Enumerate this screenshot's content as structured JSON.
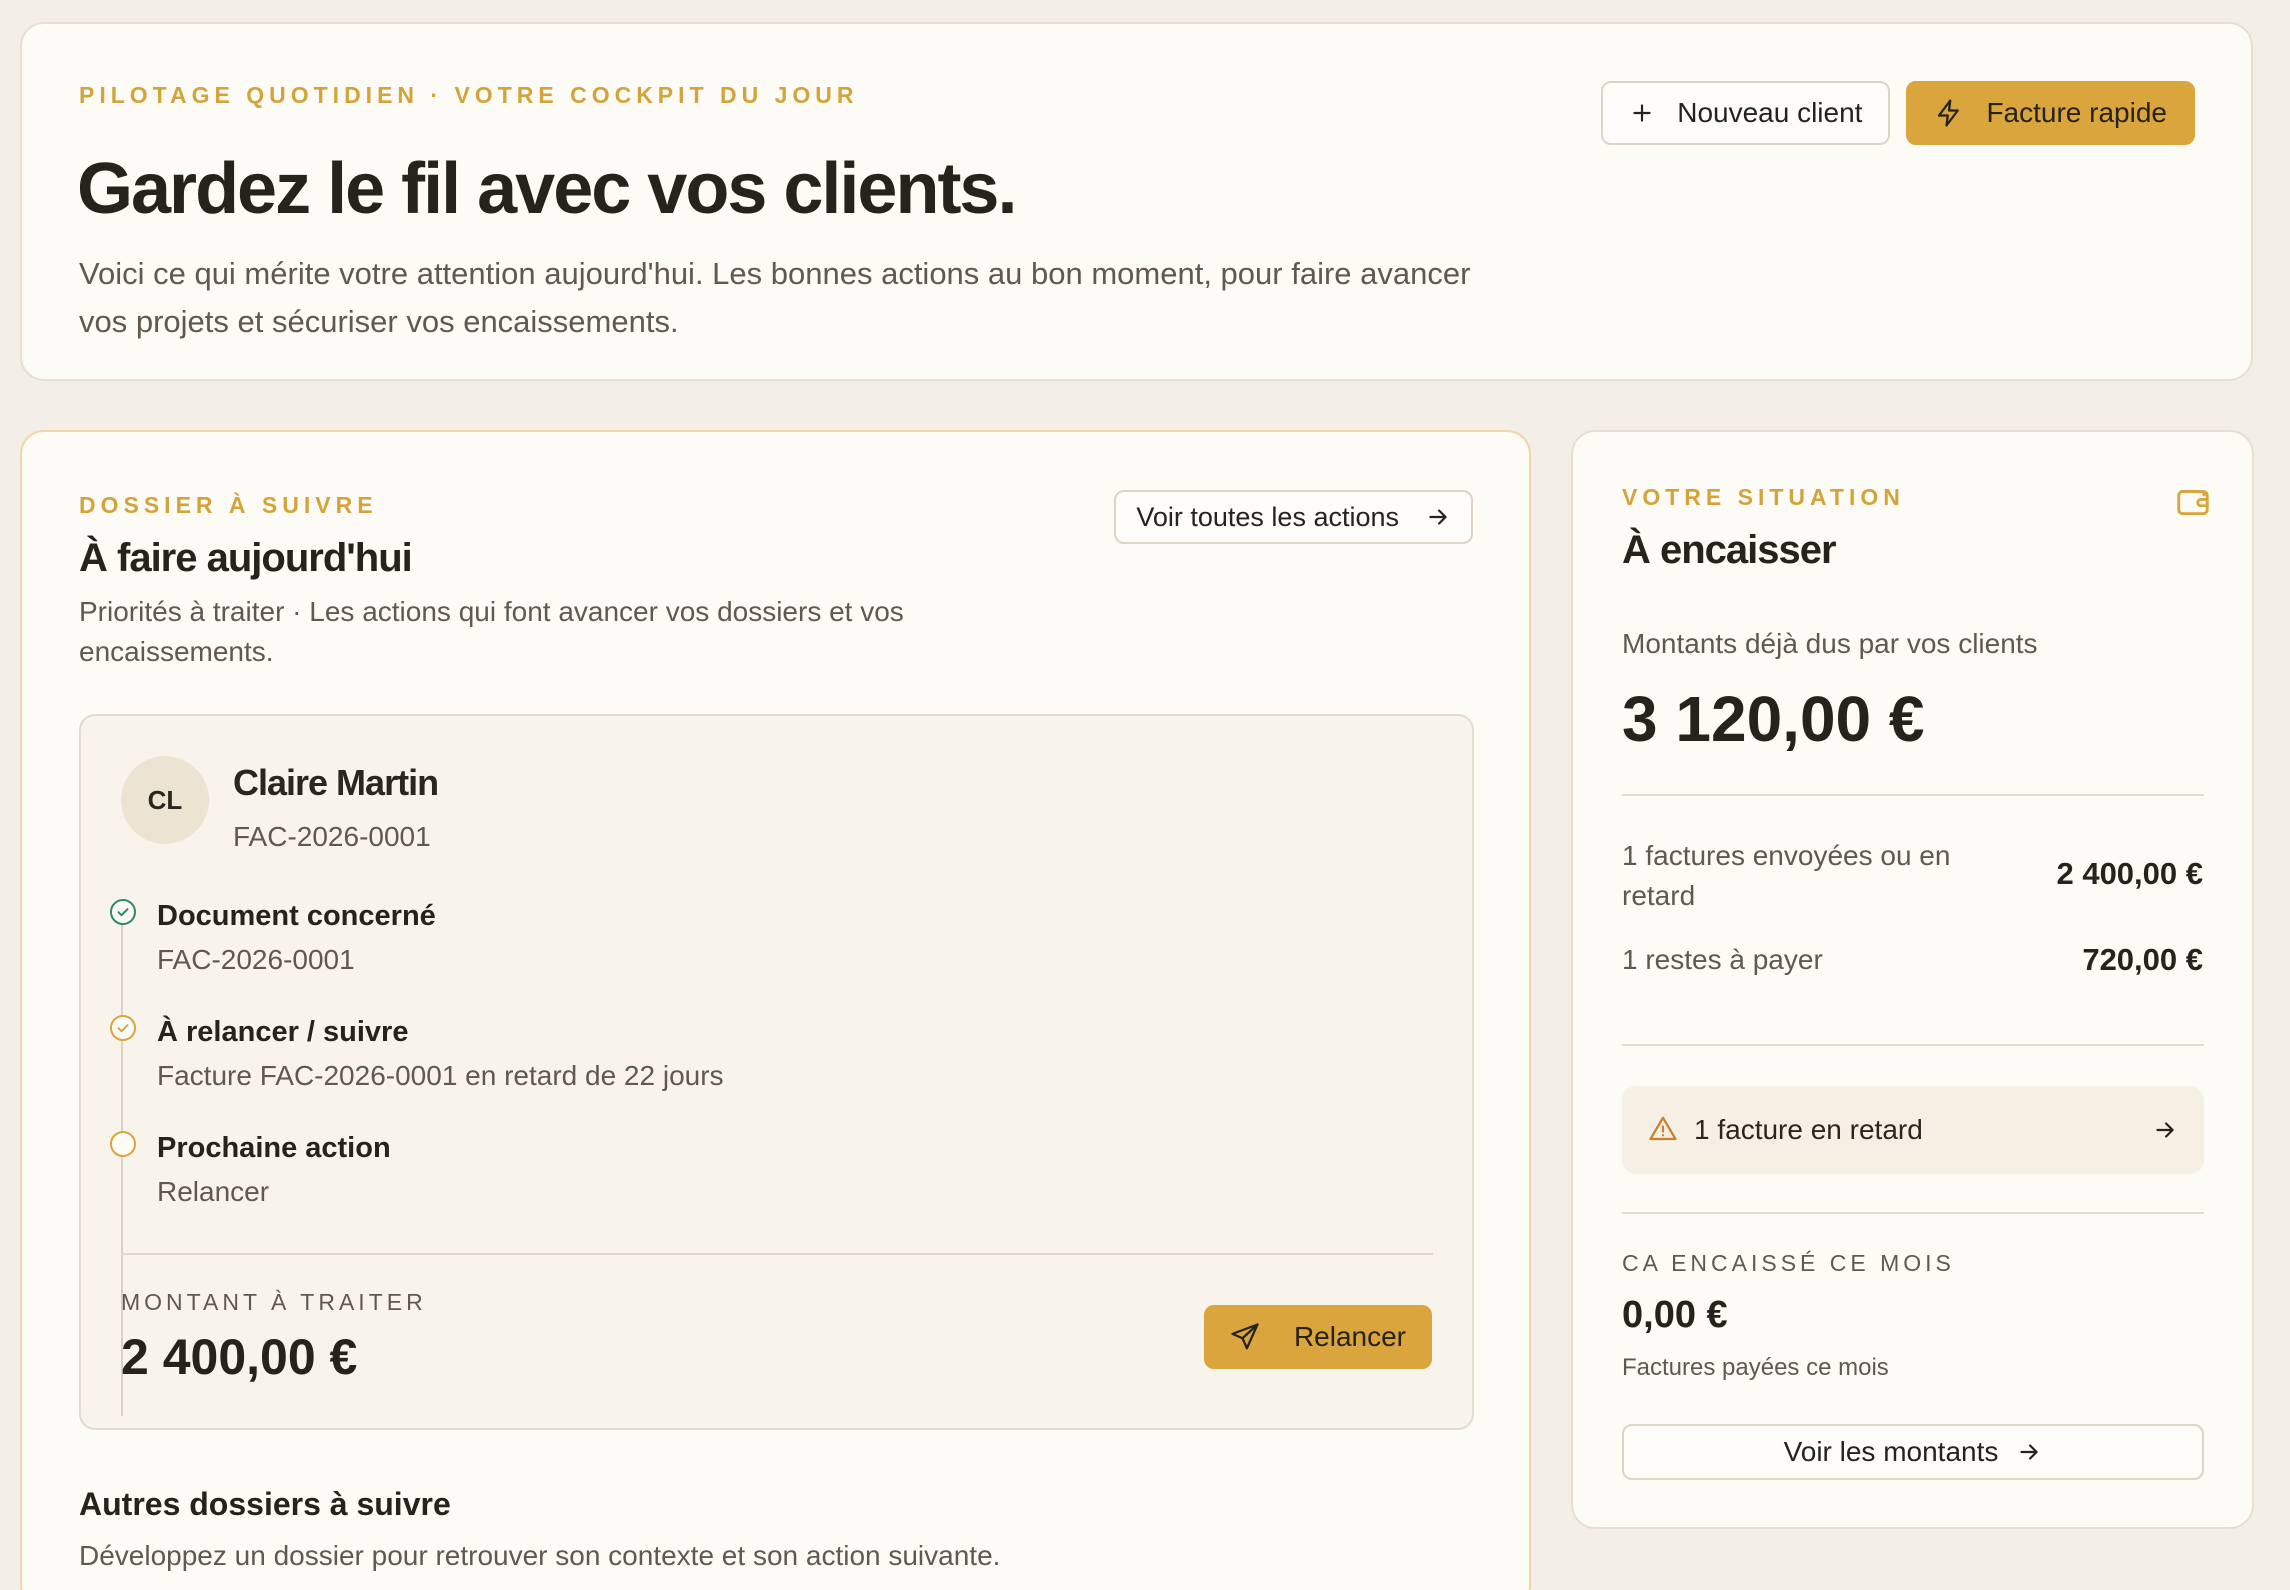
{
  "hero": {
    "eyebrow": "PILOTAGE QUOTIDIEN · VOTRE COCKPIT DU JOUR",
    "title": "Gardez le fil avec vos clients.",
    "subtitle": "Voici ce qui mérite votre attention aujourd'hui. Les bonnes actions au bon moment, pour faire avancer vos projets et sécuriser vos encaissements.",
    "new_client_label": "Nouveau client",
    "quick_invoice_label": "Facture rapide"
  },
  "today": {
    "eyebrow": "DOSSIER À SUIVRE",
    "title": "À faire aujourd'hui",
    "description": "Priorités à traiter · Les actions qui font avancer vos dossiers et vos encaissements.",
    "see_all_label": "Voir toutes les actions",
    "case": {
      "initials": "CL",
      "client_name": "Claire Martin",
      "reference": "FAC-2026-0001",
      "steps": [
        {
          "label": "Document concerné",
          "value": "FAC-2026-0001",
          "status": "done"
        },
        {
          "label": "À relancer / suivre",
          "value": "Facture FAC-2026-0001 en retard de 22 jours",
          "status": "done"
        },
        {
          "label": "Prochaine action",
          "value": "Relancer",
          "status": "pending"
        }
      ],
      "amount_label": "MONTANT À TRAITER",
      "amount_value": "2 400,00 €",
      "action_label": "Relancer"
    },
    "others_title": "Autres dossiers à suivre",
    "others_description": "Développez un dossier pour retrouver son contexte et son action suivante."
  },
  "situation": {
    "eyebrow": "VOTRE SITUATION",
    "title": "À encaisser",
    "due_label": "Montants déjà dus par vos clients",
    "due_value": "3 120,00 €",
    "rows": [
      {
        "label": "1 factures envoyées ou en retard",
        "value": "2 400,00 €"
      },
      {
        "label": "1 restes à payer",
        "value": "720,00 €"
      }
    ],
    "alert_label": "1 facture en retard",
    "month_label": "CA ENCAISSÉ CE MOIS",
    "month_value": "0,00 €",
    "month_sub": "Factures payées ce mois",
    "see_amounts_label": "Voir les montants"
  },
  "colors": {
    "accent": "#d9a53c",
    "eyebrow": "#d4a33a",
    "success": "#2f8a6a",
    "warning": "#c8832f",
    "background": "#f3efe8"
  }
}
